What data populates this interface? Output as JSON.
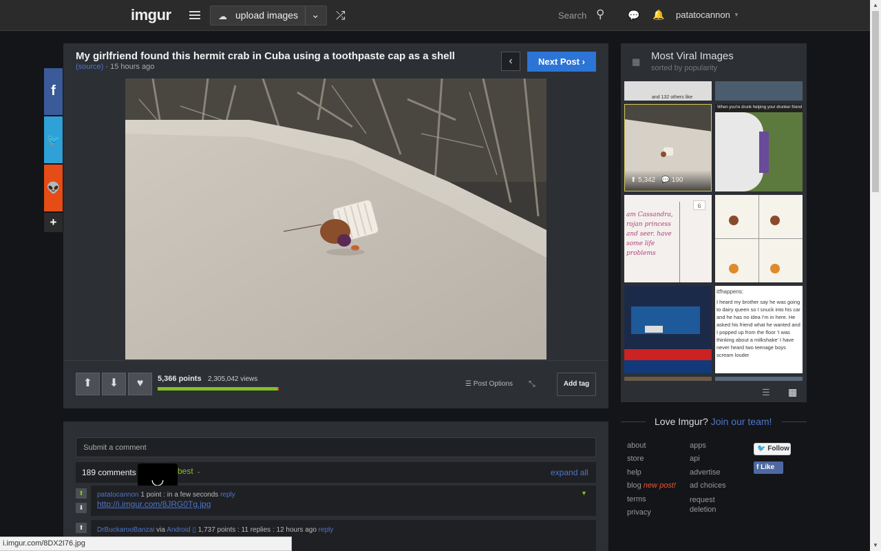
{
  "header": {
    "logo": "imgur",
    "upload_label": "upload images",
    "search_label": "Search",
    "username": "patatocannon"
  },
  "post": {
    "title": "My girlfriend found this hermit crab in Cuba using a toothpaste cap as a shell",
    "source_label": "(source)",
    "time": "15 hours ago",
    "next_label": "Next Post",
    "points": "5,366 points",
    "views": "2,305,042 views",
    "upvote_ratio": 0.99,
    "post_options": "Post Options",
    "add_tag": "Add tag"
  },
  "comments": {
    "submit_placeholder": "Submit a comment",
    "count": "189 comments",
    "sort": "best",
    "expand_all": "expand all",
    "items": [
      {
        "author": "patatocannon",
        "points_text": "1 point",
        "time": "in a few seconds",
        "reply": "reply",
        "link": "http://i.imgur.com/8JRG0Tg.jpg"
      },
      {
        "author": "DrBuckarooBanzai",
        "via": "via",
        "platform": "Android",
        "stats": "1,737 points : 11 replies : 12 hours ago",
        "reply": "reply"
      }
    ]
  },
  "status_bar": "i.imgur.com/8DX2I76.jpg",
  "sidebar": {
    "title": "Most Viral Images",
    "subtitle": "sorted by popularity",
    "top_left_caption": "and 132 others like",
    "active_thumb_points": "5,342",
    "active_thumb_comments": "190",
    "caption_drunk": "When you're drunk helping your drunker friend",
    "gallery_count": "6",
    "comic_text": "am Cassandra, rojan princess and seer. have some life problems",
    "text_post": "I heard my brother say he was going to dairy queen so I snuck into his car and he has no idea I'm in here. He asked his friend what he wanted and I popped up from the floor 'I was thinking about a milkshake' I have never heard two teenage boys scream louder",
    "text_post_header": "itfhappens:"
  },
  "love": {
    "text": "Love Imgur?",
    "link": "Join our team!"
  },
  "footer_links": {
    "col1": [
      "about",
      "store",
      "help",
      "blog",
      "terms",
      "privacy"
    ],
    "blog_new": "new post!",
    "col2": [
      "apps",
      "api",
      "advertise",
      "ad choices",
      "request deletion"
    ]
  },
  "social": {
    "follow": "Follow",
    "like": "Like"
  },
  "colors": {
    "accent_blue": "#2c75d6",
    "upvote_green": "#85bf25",
    "downvote_red": "#ee4444",
    "link_blue": "#4e76c9"
  }
}
